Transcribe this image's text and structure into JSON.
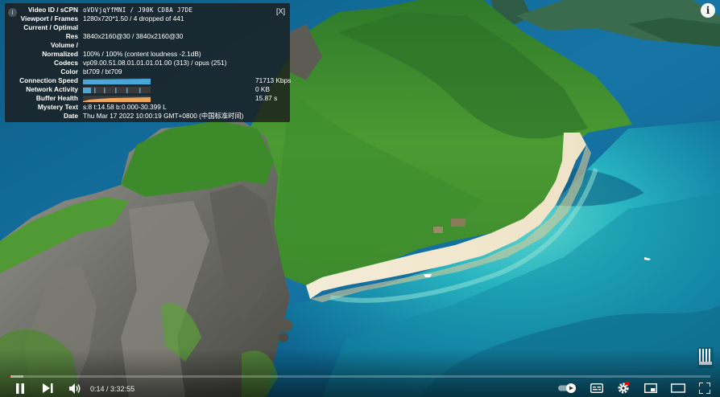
{
  "stats": {
    "close_label": "[X]",
    "rows": [
      {
        "label": "Video ID / sCPN",
        "value": "oVDVjqYfMNI / J90K CD8A J7DE",
        "mono": true
      },
      {
        "label": "Viewport / Frames",
        "value": "1280x720*1.50 / 4 dropped of 441"
      },
      {
        "label": "Current / Optimal",
        "value": ""
      },
      {
        "label": "Res",
        "value": "3840x2160@30 / 3840x2160@30"
      },
      {
        "label": "Volume /",
        "value": ""
      },
      {
        "label": "Normalized",
        "value": "100% / 100% (content loudness -2.1dB)"
      },
      {
        "label": "Codecs",
        "value": "vp09.00.51.08.01.01.01.01.00 (313) / opus (251)"
      },
      {
        "label": "Color",
        "value": "bt709 / bt709"
      }
    ],
    "graphs": [
      {
        "label": "Connection Speed",
        "value": "71713 Kbps",
        "color": "#4aa8d8"
      },
      {
        "label": "Network Activity",
        "value": "0 KB",
        "color": "#4aa8d8"
      },
      {
        "label": "Buffer Health",
        "value": "15.87 s",
        "color": "#f0a65a"
      }
    ],
    "tail_rows": [
      {
        "label": "Mystery Text",
        "value": "s:8 t:14.58 b:0.000-30.399 L"
      },
      {
        "label": "Date",
        "value": "Thu Mar 17 2022 10:00:19 GMT+0800 (中国标准时间)"
      }
    ]
  },
  "info_icon": "i",
  "player": {
    "current_time": "0:14",
    "separator": " / ",
    "duration": "3:32:55",
    "progress_played_fraction": 0.0011,
    "progress_loaded_fraction": 0.02,
    "accent_color": "#ff0000"
  },
  "icons": {
    "play_pause": "pause-icon",
    "next": "next-icon",
    "volume": "volume-icon",
    "autoplay": "autoplay-toggle-icon",
    "subtitles": "subtitles-icon",
    "settings": "settings-gear-icon",
    "miniplayer": "miniplayer-icon",
    "theater": "theater-mode-icon",
    "fullscreen": "fullscreen-icon"
  }
}
